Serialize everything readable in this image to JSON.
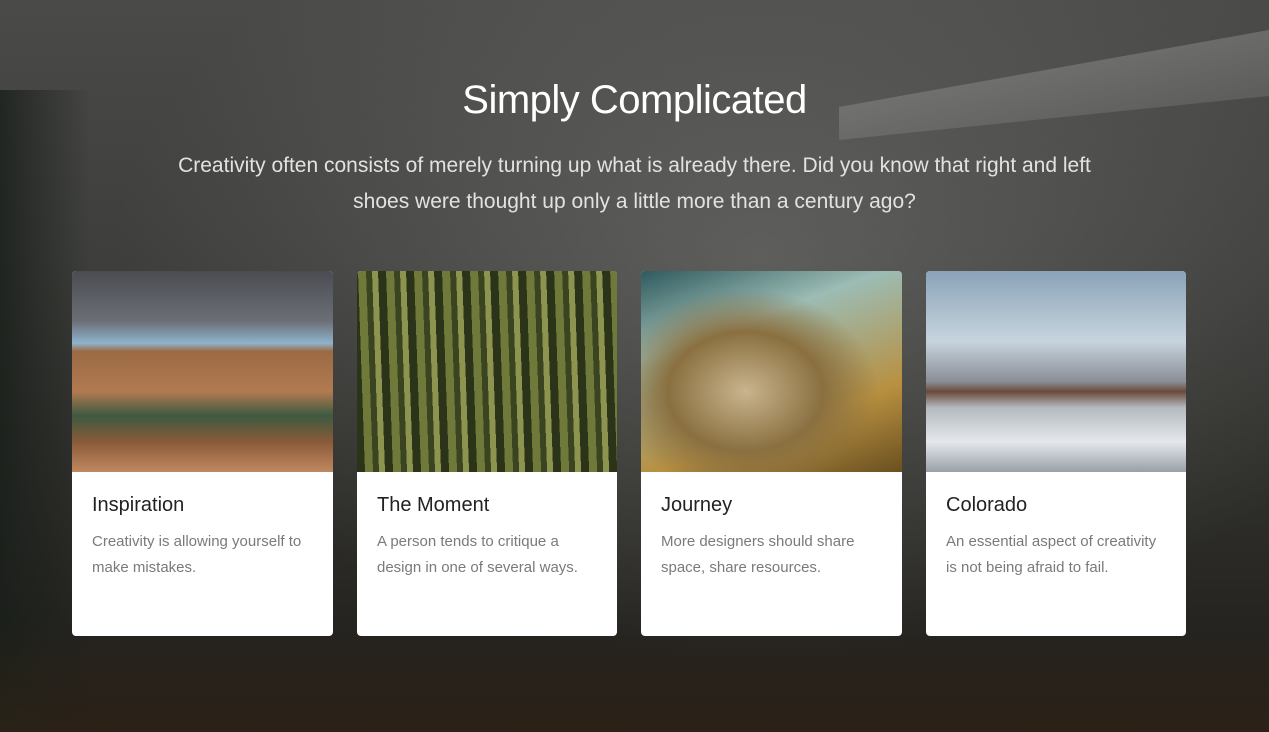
{
  "section": {
    "title": "Simply Complicated",
    "subtitle": "Creativity often consists of merely turning up what is already there. Did you know that right and left shoes were thought up only a little more than a century ago?"
  },
  "cards": [
    {
      "title": "Inspiration",
      "description": "Creativity is allowing yourself to make mistakes."
    },
    {
      "title": "The Moment",
      "description": "A person tends to critique a design in one of several ways."
    },
    {
      "title": "Journey",
      "description": "More designers should share space, share resources."
    },
    {
      "title": "Colorado",
      "description": "An essential aspect of creativity is not being afraid to fail."
    }
  ]
}
